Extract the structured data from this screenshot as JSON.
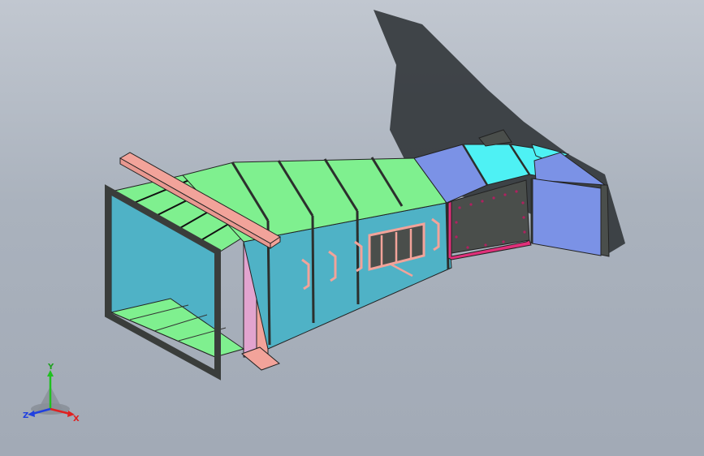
{
  "viewport": {
    "colors": {
      "background_top": "#c1c7d0",
      "background_bottom": "#a2aab6",
      "shadow": "#2e3236",
      "panel_green": "#7ff08f",
      "panel_teal": "#4fb2c6",
      "panel_blue": "#7b92e6",
      "panel_cyan": "#4ef1f4",
      "panel_dark": "#4a4e4b",
      "beam_pink": "#f2a39a",
      "flange_magenta": "#e0307a",
      "support_pink": "#e2a4cf"
    }
  },
  "model": {
    "parts": [
      "shadow",
      "inlet-frame",
      "transition-duct",
      "inspection-door",
      "rectangular-duct",
      "flexible-connector",
      "elbow",
      "outlet-hood",
      "support-beam"
    ]
  },
  "triad": {
    "x_label": "X",
    "y_label": "Y",
    "z_label": "Z",
    "x_color": "#e02020",
    "y_color": "#20c020",
    "z_color": "#2040e0"
  }
}
